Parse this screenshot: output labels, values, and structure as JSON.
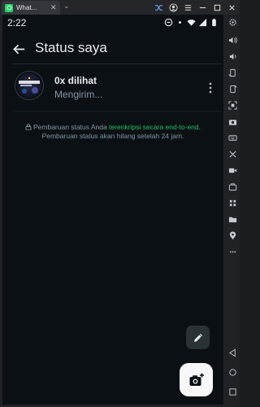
{
  "window": {
    "tab_title": "What...",
    "tab_close": "✕",
    "dropdown": "⌄"
  },
  "statusbar": {
    "time": "2:22"
  },
  "appbar": {
    "title": "Status saya"
  },
  "my_status": {
    "views": "0x dilihat",
    "state": "Mengirim..."
  },
  "encryption_note": {
    "text_before": "Pembaruan status Anda ",
    "link": "terenkripsi secara end-to-end",
    "text_after": ". Pembaruan status akan hilang setelah 24 jam."
  },
  "colors": {
    "background": "#0b1014",
    "accent_green": "#21c063",
    "primary_text": "#e9edef",
    "secondary_text": "#8696a0",
    "fab_dark": "#2b3236",
    "fab_light": "#f5f7f8"
  },
  "icons": {
    "titlebar": [
      "shuffle-icon",
      "account-icon",
      "menu-icon",
      "minimize-icon",
      "maximize-icon",
      "close-icon"
    ],
    "statusbar": [
      "do-not-disturb-icon",
      "dot-icon",
      "wifi-icon",
      "signal-icon",
      "battery-icon"
    ],
    "sidebar": [
      "settings-icon",
      "volume-up-icon",
      "volume-down-icon",
      "rotate-icon",
      "rotate-right-icon",
      "screenshot-icon",
      "camera-icon",
      "keyboard-icon",
      "shake-icon",
      "record-icon",
      "toolbox-icon",
      "apps-icon",
      "folder-icon",
      "location-icon",
      "more-icon",
      "back-icon",
      "home-icon",
      "recents-icon"
    ]
  }
}
